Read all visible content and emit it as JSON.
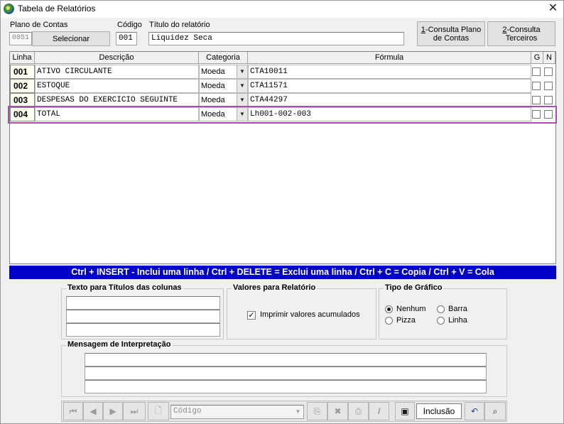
{
  "window": {
    "title": "Tabela de Relatórios",
    "close_glyph": "✕"
  },
  "form": {
    "plano_label": "Plano de Contas",
    "plano_value": "0851",
    "selecionar_label": "Selecionar",
    "codigo_label": "Código",
    "codigo_value": "001",
    "titulo_label": "Título do relatório",
    "titulo_value": "Liquidez Seca",
    "consulta_plano_key": "1",
    "consulta_plano_label": "-Consulta Plano",
    "consulta_plano_label2": "de Contas",
    "consulta_terceiros_key": "2",
    "consulta_terceiros_label": "-Consulta",
    "consulta_terceiros_label2": "Terceiros"
  },
  "grid": {
    "headers": {
      "linha": "Linha",
      "descricao": "Descrição",
      "categoria": "Categoria",
      "formula": "Fórmula",
      "g": "G",
      "n": "N"
    },
    "rows": [
      {
        "linha": "001",
        "descricao": "ATIVO CIRCULANTE",
        "categoria": "Moeda",
        "formula": "CTA10011",
        "g": false,
        "n": false
      },
      {
        "linha": "002",
        "descricao": "ESTOQUE",
        "categoria": "Moeda",
        "formula": "CTA11571",
        "g": false,
        "n": false
      },
      {
        "linha": "003",
        "descricao": "DESPESAS DO EXERCICIO SEGUINTE",
        "categoria": "Moeda",
        "formula": "CTA44297",
        "g": false,
        "n": false
      },
      {
        "linha": "004",
        "descricao": "TOTAL",
        "categoria": "Moeda",
        "formula": "Lh001-002-003",
        "g": false,
        "n": false
      }
    ],
    "selected_row": 3
  },
  "shortcuts_bar": "Ctrl + INSERT - Inclui uma linha  /  Ctrl + DELETE = Exclui uma linha / Ctrl + C = Copia / Ctrl + V = Cola",
  "titulos_group": {
    "label": "Texto para Títulos das colunas",
    "values": [
      "",
      "",
      ""
    ]
  },
  "valores_group": {
    "label": "Valores para Relatório",
    "checkbox_label": "Imprimir valores acumulados",
    "checked": true
  },
  "grafico_group": {
    "label": "Tipo de Gráfico",
    "options": [
      "Nenhum",
      "Barra",
      "Pizza",
      "Linha"
    ],
    "selected": "Nenhum"
  },
  "mensagem_group": {
    "label": "Mensagem de Interpretação",
    "lines": [
      "",
      "",
      ""
    ]
  },
  "toolbar": {
    "search_placeholder": "Código",
    "mode_label": "Inclusão",
    "icons": {
      "first": "first-record-icon",
      "prev": "previous-record-icon",
      "next": "next-record-icon",
      "last": "last-record-icon",
      "new": "new-document-icon",
      "copy": "copy-record-icon",
      "delete": "delete-record-icon",
      "print": "print-icon",
      "italic": "italic-icon",
      "save": "save-icon",
      "undo": "undo-icon",
      "search": "binoculars-icon"
    }
  },
  "colors": {
    "accent_blue": "#0000c8",
    "selection": "#a64fb0",
    "line_cell_bg": "#fffff0"
  }
}
